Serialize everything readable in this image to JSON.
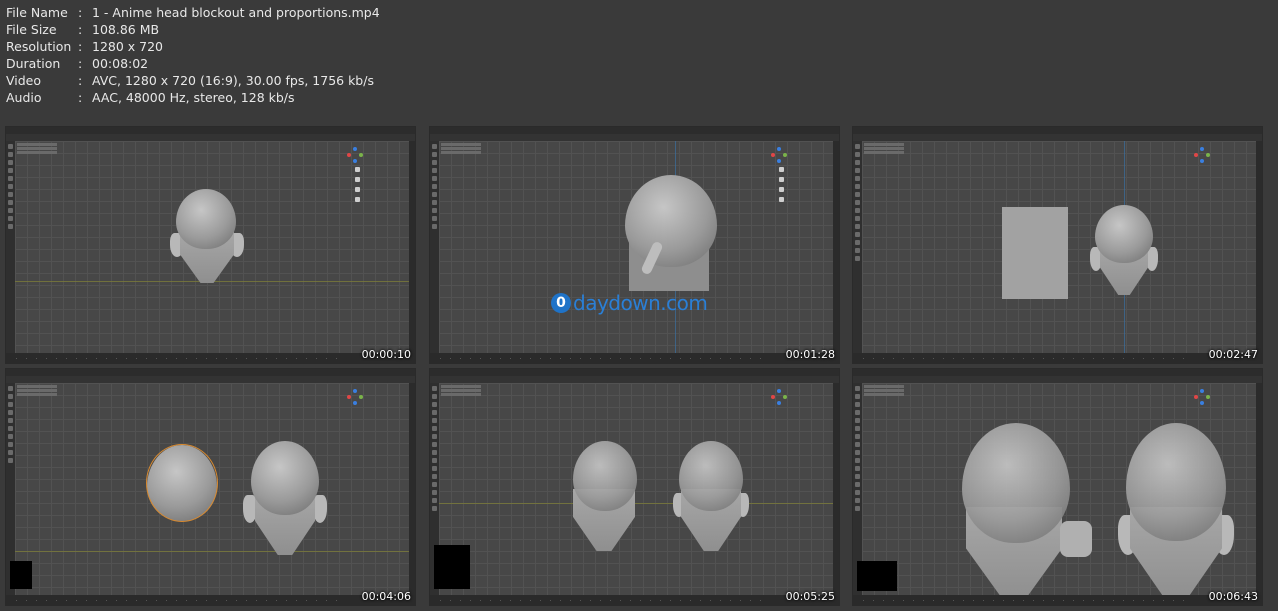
{
  "file_info": [
    {
      "label": "File Name",
      "value": "1 - Anime head blockout and proportions.mp4"
    },
    {
      "label": "File Size",
      "value": "108.86 MB"
    },
    {
      "label": "Resolution",
      "value": "1280 x 720"
    },
    {
      "label": "Duration",
      "value": "00:08:02"
    },
    {
      "label": "Video",
      "value": "AVC, 1280 x 720 (16:9), 30.00 fps, 1756 kb/s"
    },
    {
      "label": "Audio",
      "value": "AAC, 48000 Hz, stereo, 128 kb/s"
    }
  ],
  "separator": ":",
  "thumbnails": [
    {
      "timestamp": "00:00:10"
    },
    {
      "timestamp": "00:01:28"
    },
    {
      "timestamp": "00:02:47"
    },
    {
      "timestamp": "00:04:06"
    },
    {
      "timestamp": "00:05:25"
    },
    {
      "timestamp": "00:06:43"
    }
  ],
  "watermark": {
    "logo_letter": "0",
    "text": "daydown.com"
  },
  "colors": {
    "background": "#3a3a3a",
    "viewport": "#474747",
    "selection_outline": "#d98a2f",
    "watermark_blue": "#2a7fd6"
  }
}
